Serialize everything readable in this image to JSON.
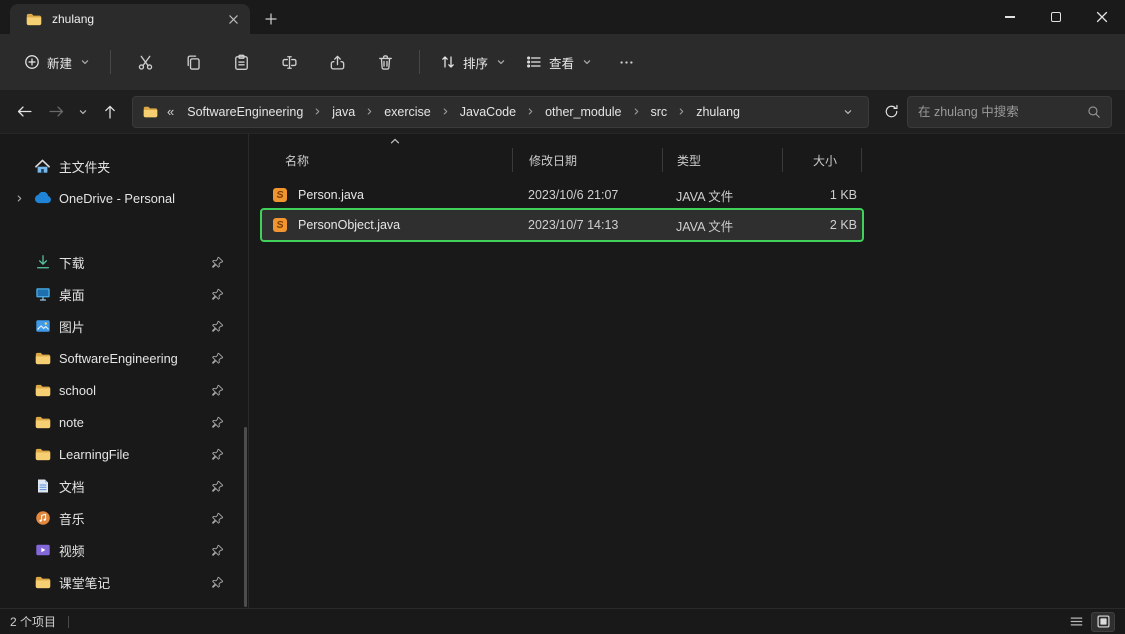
{
  "titlebar": {
    "tab_title": "zhulang"
  },
  "toolbar": {
    "new_label": "新建",
    "sort_label": "排序",
    "view_label": "查看"
  },
  "navigation": {
    "overflow_indicator": "«",
    "breadcrumb": [
      "SoftwareEngineering",
      "java",
      "exercise",
      "JavaCode",
      "other_module",
      "src",
      "zhulang"
    ],
    "search_placeholder": "在 zhulang 中搜索"
  },
  "sidebar": {
    "items": [
      {
        "label": "主文件夹",
        "icon": "home",
        "pinned": false
      },
      {
        "label": "OneDrive - Personal",
        "icon": "onedrive-cloud",
        "pinned": false
      },
      {
        "label": "下载",
        "icon": "downloads-arrow",
        "pinned": true
      },
      {
        "label": "桌面",
        "icon": "desktop-monitor",
        "pinned": true
      },
      {
        "label": "图片",
        "icon": "pictures-photo",
        "pinned": true
      },
      {
        "label": "SoftwareEngineering",
        "icon": "folder",
        "pinned": true
      },
      {
        "label": "school",
        "icon": "folder",
        "pinned": true
      },
      {
        "label": "note",
        "icon": "folder",
        "pinned": true
      },
      {
        "label": "LearningFile",
        "icon": "folder",
        "pinned": true
      },
      {
        "label": "文档",
        "icon": "document",
        "pinned": true
      },
      {
        "label": "音乐",
        "icon": "music-disc",
        "pinned": true
      },
      {
        "label": "视频",
        "icon": "video-player",
        "pinned": true
      },
      {
        "label": "课堂笔记",
        "icon": "folder",
        "pinned": true
      }
    ]
  },
  "files": {
    "columns": [
      "名称",
      "修改日期",
      "类型",
      "大小"
    ],
    "sort_column": "名称",
    "sort_direction": "ascending",
    "rows": [
      {
        "name": "Person.java",
        "date": "2023/10/6 21:07",
        "type": "JAVA 文件",
        "size": "1 KB",
        "selected": false
      },
      {
        "name": "PersonObject.java",
        "date": "2023/10/7 14:13",
        "type": "JAVA 文件",
        "size": "2 KB",
        "selected": true
      }
    ]
  },
  "statusbar": {
    "items_count": "2 个项目"
  },
  "colors": {
    "selection_outline": "#3fd159",
    "folder_yellow": "#f5cf72",
    "onedrive_blue": "#1f84d8",
    "java_icon_orange": "#f0952f",
    "toolbar_surface": "#2b2b2b",
    "window_background": "#191919"
  },
  "icons": {
    "new": "plus-circle",
    "cut": "scissors",
    "copy": "two-rectangles",
    "paste": "clipboard",
    "rename": "text-cursor-box",
    "share": "arrow-out-of-tray",
    "delete": "trash-can",
    "sort": "up-down-arrows",
    "view": "list-lines",
    "more": "ellipsis",
    "back": "arrow-left",
    "forward": "arrow-right",
    "up": "arrow-up",
    "refresh": "circular-arrow",
    "search": "magnifier",
    "pin": "pushpin",
    "chevron_down": "⌄",
    "chevron_right": "›"
  }
}
